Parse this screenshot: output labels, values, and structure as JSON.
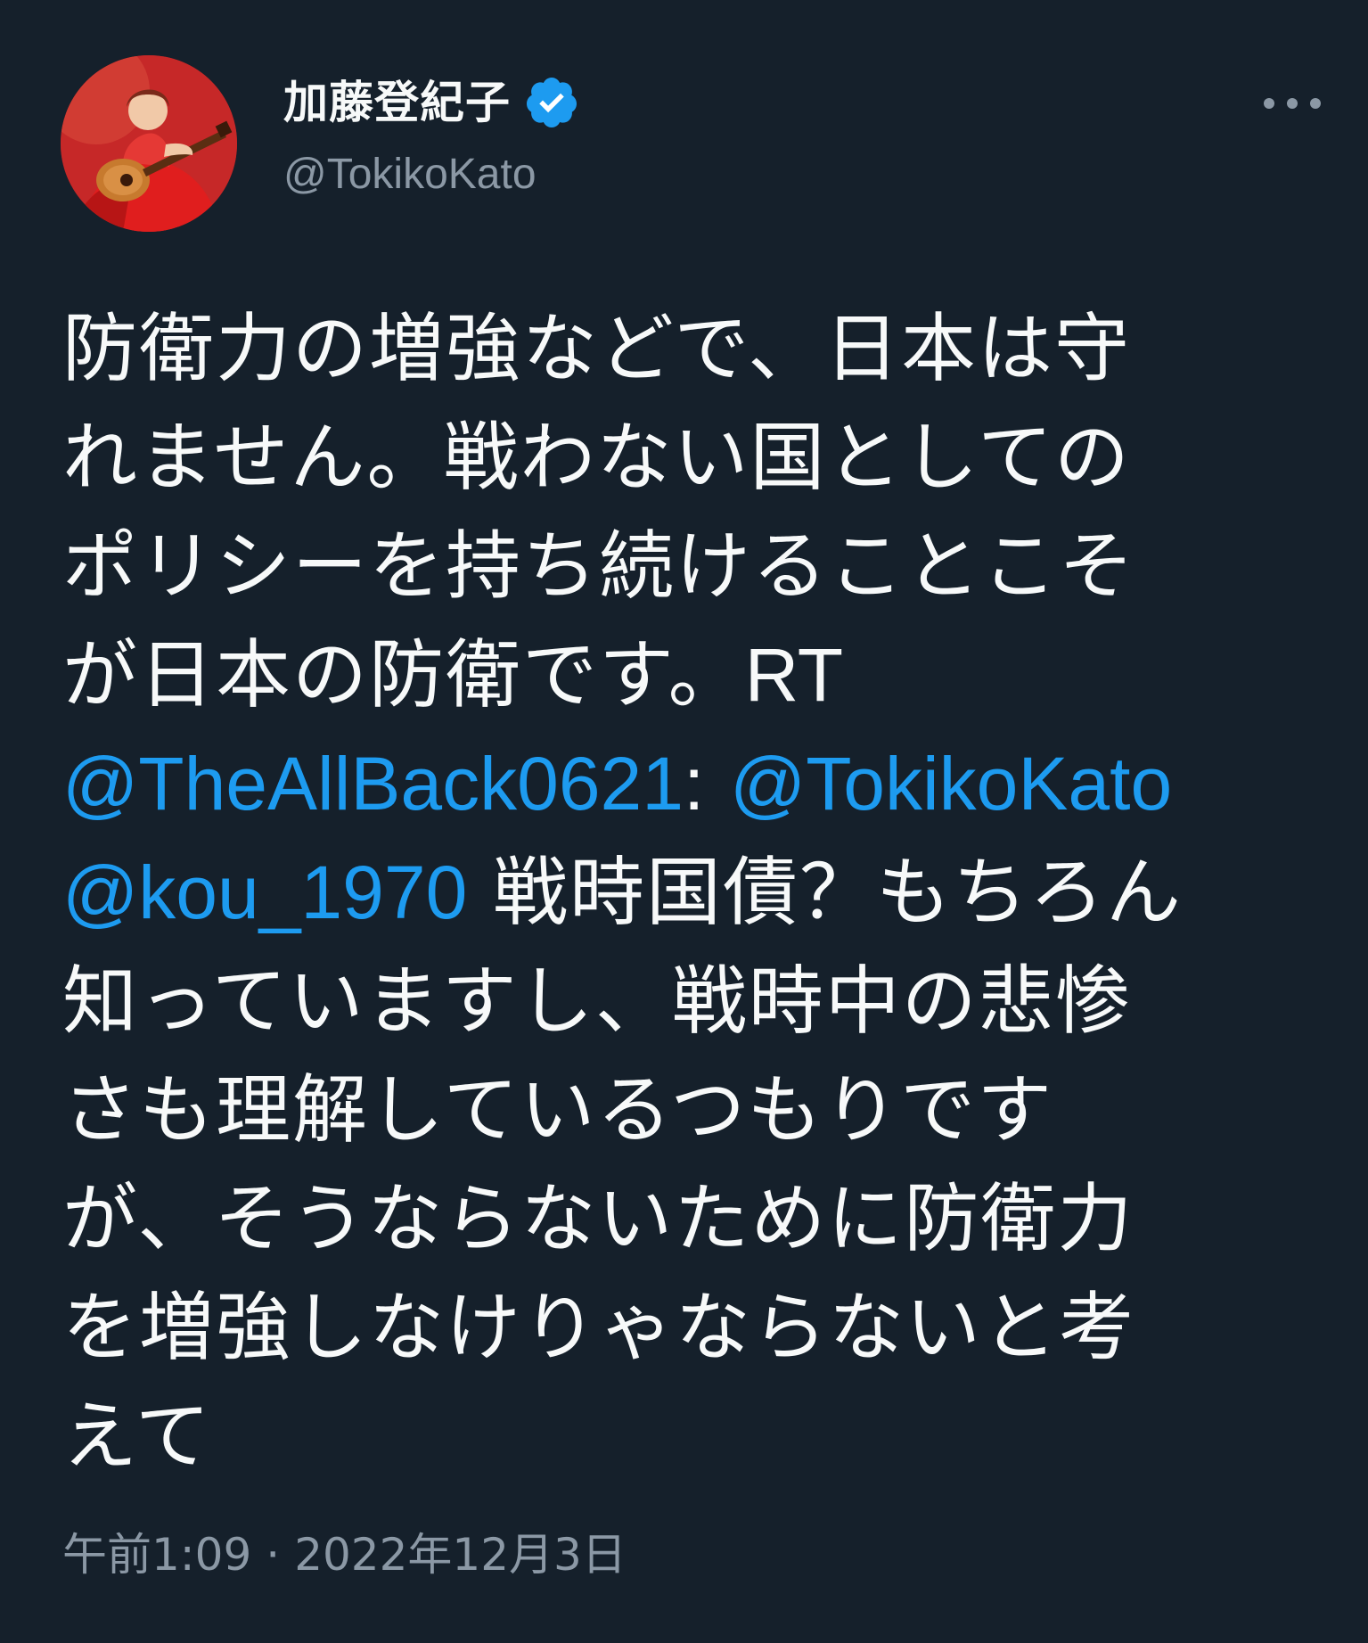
{
  "author": {
    "display_name": "加藤登紀子",
    "handle": "@TokikoKato",
    "verified": true,
    "avatar_icon": "profile-photo-woman-red-dress-guitar"
  },
  "more_icon": "ellipsis-icon",
  "body": {
    "line1": "防衛力の増強などで、日本は守",
    "line2": "れません。戦わない国としての",
    "line3": "ポリシーを持ち続けることこそ",
    "line4_text": "が日本の防衛です。",
    "line4_rt": "RT",
    "mention1": "@TheAllBack0621",
    "colon": ":",
    "mention2": "@TokikoKato",
    "mention3": "@kou_1970",
    "line6_text": "戦時国債？もちろん",
    "line7": "知っていますし、戦時中の悲惨",
    "line8": "さも理解しているつもりです",
    "line9": "が、そうならないために防衛力",
    "line10": "を増強しなけりゃならないと考",
    "line11": "えて"
  },
  "meta": {
    "time": "午前1:09",
    "separator": "·",
    "date": "2022年12月3日"
  },
  "colors": {
    "background": "#15202b",
    "text": "#f7f9f9",
    "secondary": "#8b98a5",
    "link": "#1d9bf0",
    "verified": "#1d9bf0"
  }
}
